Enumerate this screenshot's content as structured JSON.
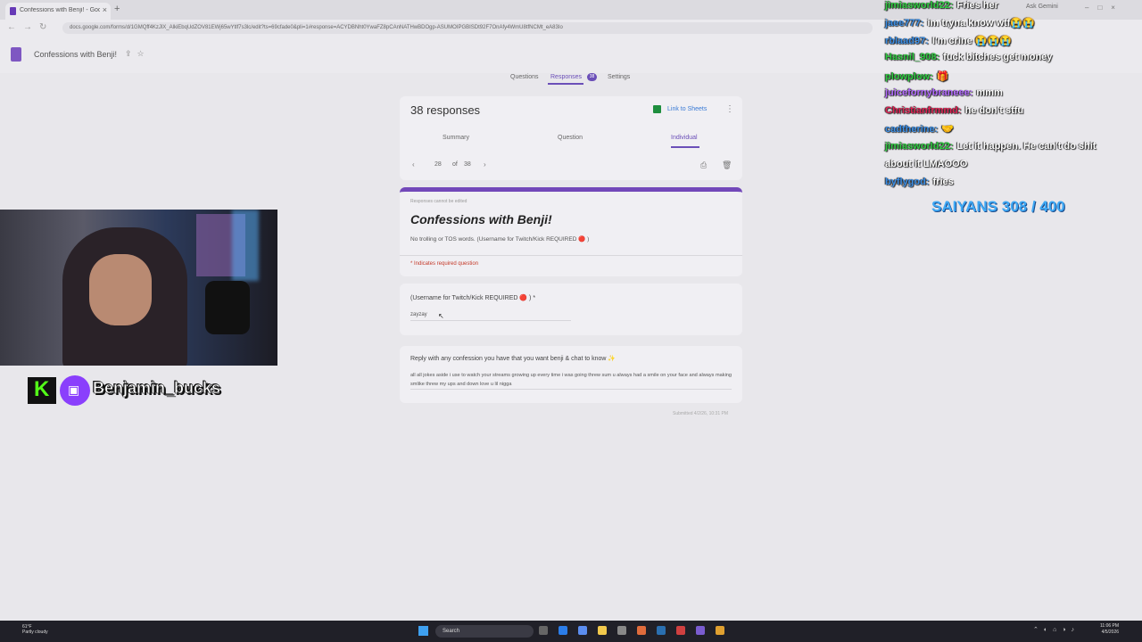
{
  "browser": {
    "tab_title": "Confessions with Benji! - Google",
    "url": "docs.google.com/forms/d/1GMQff4KzJlX_AlkiEbqUdZOV81EWj65wYtlf7s3lc/edit?ts=69cfade0&pli=1#response=ACYDBNht0YwaFZ8pCAnNATHwBDOgp-ASUMOIPGBISDt92F7OnAfy4WmU8tfNCMt_eA83Io",
    "gemini_label": "Ask Gemini"
  },
  "form_header": {
    "doc_title": "Confessions with Benji!",
    "tabs": {
      "questions": "Questions",
      "responses": "Responses",
      "responses_badge": "38",
      "settings": "Settings"
    }
  },
  "responses": {
    "count": "38 responses",
    "link_sheets": "Link to Sheets",
    "subtabs": {
      "summary": "Summary",
      "question": "Question",
      "individual": "Individual"
    },
    "pager": {
      "current": "28",
      "of": "of",
      "total": "38"
    }
  },
  "form": {
    "cannot_edit": "Responses cannot be edited",
    "title": "Confessions with Benji!",
    "description": "No trolling or TOS words. (Username for Twitch/Kick REQUIRED 🔴 )",
    "required_note": "* Indicates required question",
    "q1": {
      "label": "(Username for Twitch/Kick REQUIRED 🔴 ) *",
      "answer": "zayzay"
    },
    "q2": {
      "label": "Reply with any confession you have that you want benji & chat to know ✨",
      "answer": "all all jokes aside i use to watch your streams growing up every time i was going threw sum u always had a smile on your face and always making smlike threw my ups and down love u lil nigga"
    },
    "submitted": "Submitted 4/2/26, 10:31 PM"
  },
  "overlay": {
    "streamer_name": "Benjamin_bucks",
    "goal_text": "SAIYANS 308 / 400"
  },
  "chat": [
    {
      "user": "jimiasworld22:",
      "text": "Fries her",
      "color": "#2ecc40"
    },
    {
      "user": "jaee777:",
      "text": "im tryna know wtf😭😭",
      "color": "#3a8ee6"
    },
    {
      "user": "rblaad97:",
      "text": "I'm crine 😭😭😭",
      "color": "#3a8ee6"
    },
    {
      "user": "Hasnil_908:",
      "text": "fuck bitches get money",
      "color": "#2ecc40"
    },
    {
      "user": "plowplow:",
      "text": "🎁",
      "color": "#2ecc40"
    },
    {
      "user": "juicefornybraneee:",
      "text": "mmm",
      "color": "#b36bff"
    },
    {
      "user": "Christianfrmmd:",
      "text": "he don't stfu",
      "color": "#e02052"
    },
    {
      "user": "cadtherine:",
      "text": "🤝",
      "color": "#3a8ee6"
    },
    {
      "user": "jimiasworld22:",
      "text": "Let it happen. He can't do shit",
      "color": "#2ecc40"
    },
    {
      "user": "",
      "text": "about it LMAOOO",
      "color": "#ffffff"
    },
    {
      "user": "byflygod:",
      "text": "fries",
      "color": "#3a8ee6"
    }
  ],
  "taskbar": {
    "weather_temp": "61°F",
    "weather_desc": "Partly cloudy",
    "search": "Search",
    "time": "11:06 PM",
    "date": "4/5/2026"
  }
}
